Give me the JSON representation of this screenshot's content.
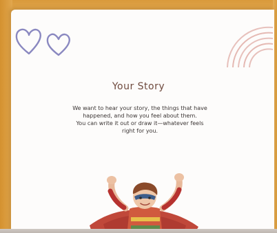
{
  "story": {
    "title": "Your Story",
    "lines": [
      "We want to hear your story, the things that have",
      "happened, and how you feel about them.",
      "You can write it out or draw it—whatever feels",
      "right for you."
    ]
  },
  "decor": {
    "hearts_icon": "hearts-outline-icon",
    "rainbow_icon": "rainbow-outline-icon",
    "illustration": "superhero-child-illustration"
  },
  "colors": {
    "frame": "#dca040",
    "heart_stroke": "#8a88c0",
    "rainbow_stroke": "#e5b9b3",
    "title": "#6f4a3e",
    "text": "#3a3433"
  }
}
